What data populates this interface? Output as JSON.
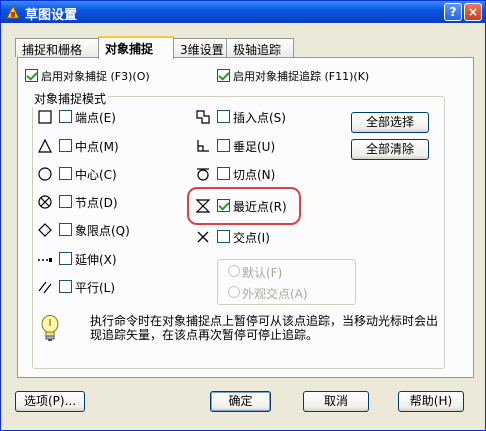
{
  "window": {
    "title": "草图设置",
    "help_btn": "?",
    "close_btn": "×"
  },
  "tabs": [
    {
      "label": "捕捉和栅格",
      "active": false
    },
    {
      "label": "对象捕捉",
      "active": true
    },
    {
      "label": "3维设置",
      "active": false
    },
    {
      "label": "极轴追踪",
      "active": false
    }
  ],
  "top_options": {
    "snap_on": {
      "label": "启用对象捕捉 (F3)(O)",
      "checked": true
    },
    "tracking_on": {
      "label": "启用对象捕捉追踪 (F11)(K)",
      "checked": true
    }
  },
  "group": {
    "title": "对象捕捉模式",
    "left_modes": [
      {
        "icon": "square-endpoint-icon",
        "label": "端点(E)",
        "checked": false
      },
      {
        "icon": "triangle-midpoint-icon",
        "label": "中点(M)",
        "checked": false
      },
      {
        "icon": "circle-center-icon",
        "label": "中心(C)",
        "checked": false
      },
      {
        "icon": "node-icon",
        "label": "节点(D)",
        "checked": false
      },
      {
        "icon": "diamond-quadrant-icon",
        "label": "象限点(Q)",
        "checked": false
      },
      {
        "icon": "extension-icon",
        "label": "延伸(X)",
        "checked": false
      },
      {
        "icon": "parallel-icon",
        "label": "平行(L)",
        "checked": false
      }
    ],
    "right_modes": [
      {
        "icon": "insertion-icon",
        "label": "插入点(S)",
        "checked": false
      },
      {
        "icon": "perpendicular-icon",
        "label": "垂足(U)",
        "checked": false
      },
      {
        "icon": "tangent-icon",
        "label": "切点(N)",
        "checked": false
      },
      {
        "icon": "nearest-icon",
        "label": "最近点(R)",
        "checked": true
      },
      {
        "icon": "intersection-icon",
        "label": "交点(I)",
        "checked": false
      }
    ],
    "select_all": "全部选择",
    "clear_all": "全部清除",
    "sub_options": [
      {
        "label": "默认(F)",
        "enabled": false
      },
      {
        "label": "外观交点(A)",
        "enabled": false
      }
    ],
    "info_line1": "执行命令时在对象捕捉点上暂停可从该点追踪，当移动光标时会出",
    "info_line2": "现追踪矢量，在该点再次暂停可停止追踪。"
  },
  "footer": {
    "options": "选项(P)...",
    "ok": "确定",
    "cancel": "取消",
    "help": "帮助(H)"
  }
}
